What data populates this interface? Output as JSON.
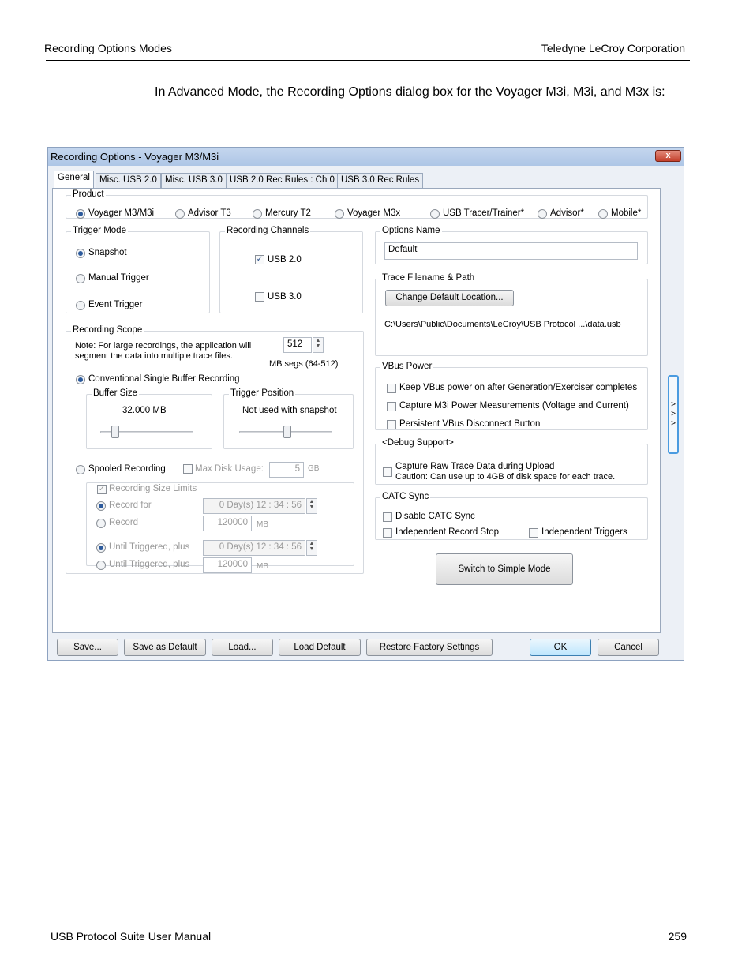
{
  "page_header": {
    "left": "Recording Options Modes",
    "right": "Teledyne  LeCroy Corporation"
  },
  "intro_text": "In Advanced Mode, the Recording Options dialog box for the Voyager M3i, M3i, and M3x is:",
  "footer": {
    "left": "USB Protocol Suite User Manual",
    "page_number": "259"
  },
  "dialog": {
    "title": "Recording Options - Voyager M3/M3i",
    "close_glyph": "x",
    "tabs": [
      "General",
      "Misc. USB 2.0",
      "Misc. USB 3.0",
      "USB 2.0 Rec Rules : Ch 0",
      "USB 3.0 Rec Rules"
    ],
    "product": {
      "label": "Product",
      "options": [
        "Voyager M3/M3i",
        "Advisor T3",
        "Mercury T2",
        "Voyager M3x",
        "USB Tracer/Trainer*",
        "Advisor*",
        "Mobile*"
      ],
      "selected": "Voyager M3/M3i"
    },
    "trigger_mode": {
      "label": "Trigger Mode",
      "options": [
        "Snapshot",
        "Manual Trigger",
        "Event Trigger"
      ],
      "selected": "Snapshot"
    },
    "recording_channels": {
      "label": "Recording Channels",
      "usb2": {
        "label": "USB 2.0",
        "checked": true
      },
      "usb3": {
        "label": "USB 3.0",
        "checked": false
      }
    },
    "recording_scope": {
      "label": "Recording Scope",
      "note_line1": "Note: For large recordings, the application will",
      "note_line2": "segment the data into multiple trace files.",
      "segment_value": "512",
      "segment_unit": "MB segs (64-512)",
      "conventional_label": "Conventional Single Buffer Recording",
      "buffer_size_label": "Buffer Size",
      "buffer_size_value": "32.000 MB",
      "trigger_position_label": "Trigger Position",
      "trigger_position_value": "Not used with snapshot",
      "spooled_label": "Spooled Recording",
      "max_disk_label": "Max Disk Usage:",
      "max_disk_value": "5",
      "max_disk_unit": "GB",
      "size_limits_label": "Recording Size Limits",
      "record_for_label": "Record for",
      "record_for_value": "0 Day(s)  12 : 34 : 56",
      "record_label": "Record",
      "record_value": "120000",
      "record_unit": "MB",
      "until_triggered_label": "Until Triggered, plus",
      "until_triggered_time": "0 Day(s)  12 : 34 : 56",
      "until_triggered_label2": "Until Triggered, plus",
      "until_triggered_value": "120000",
      "until_triggered_unit": "MB"
    },
    "options_name": {
      "label": "Options Name",
      "value": "Default"
    },
    "trace_filename": {
      "label": "Trace Filename & Path",
      "button": "Change Default Location...",
      "path": "C:\\Users\\Public\\Documents\\LeCroy\\USB Protocol ...\\data.usb"
    },
    "vbus_power": {
      "label": "VBus Power",
      "options": [
        "Keep VBus power on after Generation/Exerciser completes",
        "Capture M3i Power Measurements (Voltage and Current)",
        "Persistent VBus Disconnect Button"
      ]
    },
    "debug_support": {
      "label": "<Debug Support>",
      "line1": "Capture Raw Trace Data during Upload",
      "line2": "Caution: Can use up to 4GB of disk space for each trace."
    },
    "catc_sync": {
      "label": "CATC Sync",
      "disable": "Disable CATC Sync",
      "independent_stop": "Independent Record Stop",
      "independent_triggers": "Independent Triggers"
    },
    "switch_button": "Switch to Simple Mode",
    "side_tab_glyph": "> > >",
    "bottom_buttons": [
      "Save...",
      "Save as Default",
      "Load...",
      "Load Default",
      "Restore Factory Settings",
      "OK",
      "Cancel"
    ]
  }
}
